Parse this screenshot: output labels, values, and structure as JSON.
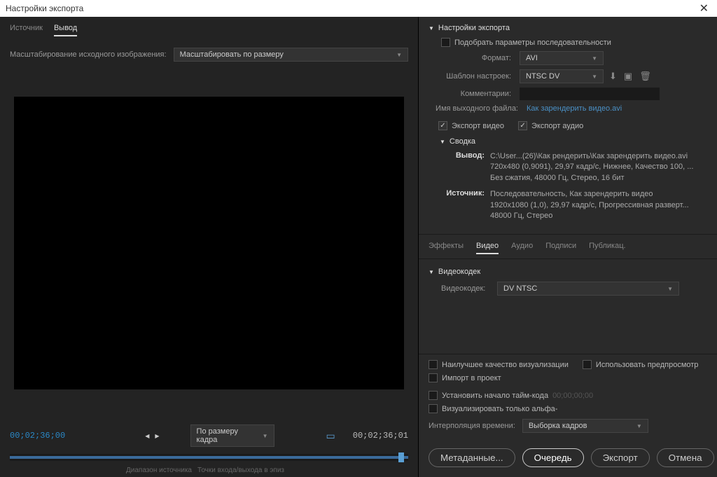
{
  "window": {
    "title": "Настройки экспорта"
  },
  "leftTabs": {
    "source": "Источник",
    "output": "Вывод"
  },
  "scaling": {
    "label": "Масштабирование исходного изображения:",
    "value": "Масштабировать по размеру"
  },
  "timecodes": {
    "start": "00;02;36;00",
    "end": "00;02;36;01"
  },
  "fit": {
    "value": "По размеру кадра"
  },
  "sourceRange": {
    "label": "Диапазон источника",
    "value": "Точки входа/выхода в эпиз"
  },
  "exportSettings": {
    "header": "Настройки экспорта",
    "matchSequence": "Подобрать параметры последовательности",
    "formatLabel": "Формат:",
    "format": "AVI",
    "presetLabel": "Шаблон настроек:",
    "preset": "NTSC DV",
    "commentLabel": "Комментарии:",
    "outputNameLabel": "Имя выходного файла:",
    "outputName": "Как зарендерить видео.avi",
    "exportVideo": "Экспорт видео",
    "exportAudio": "Экспорт аудио"
  },
  "summary": {
    "header": "Сводка",
    "outputLabel": "Вывод:",
    "outputText": "C:\\User...(26)\\Как рендерить\\Как зарендерить видео.avi\n720x480 (0,9091), 29,97 кадр/с, Нижнее, Качество 100, ...\nБез сжатия, 48000 Гц, Стерео, 16 бит",
    "sourceLabel": "Источник:",
    "sourceText": "Последовательность, Как зарендерить видео\n1920x1080 (1,0), 29,97 кадр/с, Прогрессивная разверт...\n48000 Гц, Стерео"
  },
  "subTabs": {
    "effects": "Эффекты",
    "video": "Видео",
    "audio": "Аудио",
    "captions": "Подписи",
    "publish": "Публикац."
  },
  "codec": {
    "header": "Видеокодек",
    "label": "Видеокодек:",
    "value": "DV NTSC"
  },
  "bottomOpts": {
    "bestQuality": "Наилучшее качество визуализации",
    "usePreviews": "Использовать предпросмотр",
    "importProject": "Импорт в проект",
    "setStartTC": "Установить начало тайм-кода",
    "startTCValue": "00;00;00;00",
    "alphaOnly": "Визуализировать только альфа-",
    "interpLabel": "Интерполяция времени:",
    "interpValue": "Выборка кадров"
  },
  "buttons": {
    "metadata": "Метаданные...",
    "queue": "Очередь",
    "export": "Экспорт",
    "cancel": "Отмена"
  }
}
